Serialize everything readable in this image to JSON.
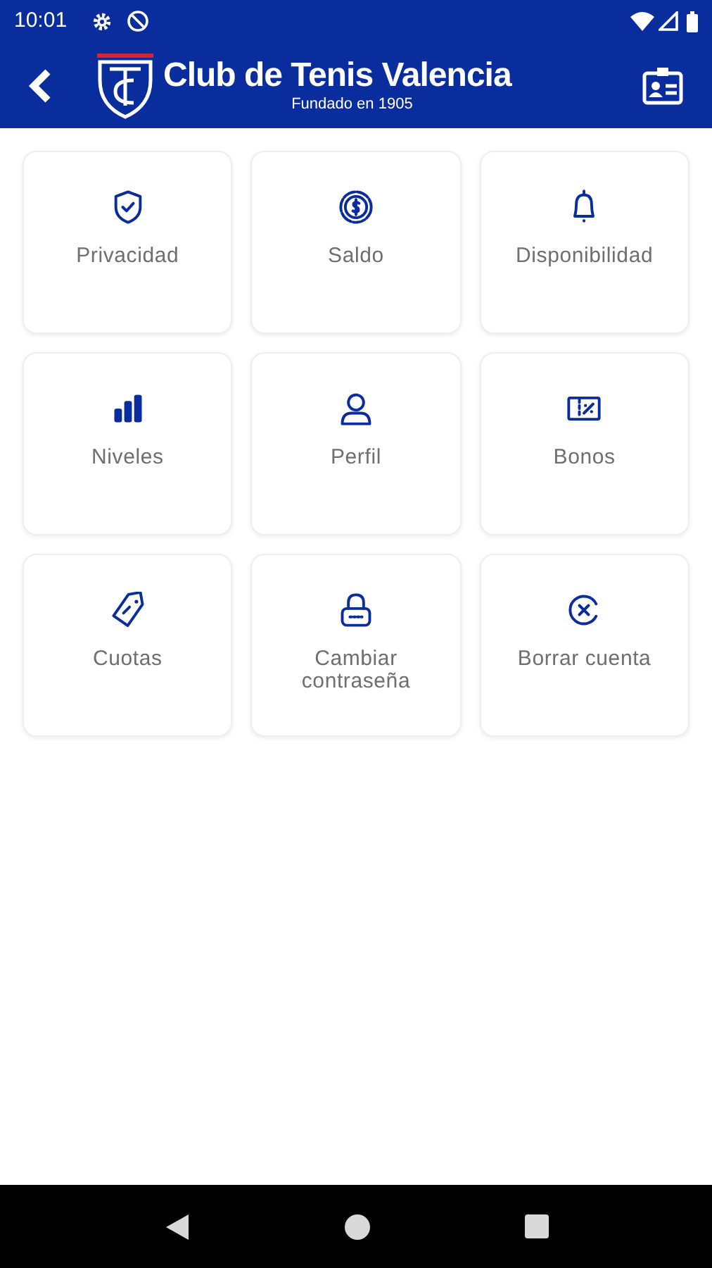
{
  "status_bar": {
    "time": "10:01"
  },
  "app_bar": {
    "title": "Club de Tenis Valencia",
    "subtitle": "Fundado en 1905"
  },
  "tiles": [
    {
      "label": "Privacidad"
    },
    {
      "label": "Saldo"
    },
    {
      "label": "Disponibilidad"
    },
    {
      "label": "Niveles"
    },
    {
      "label": "Perfil"
    },
    {
      "label": "Bonos"
    },
    {
      "label": "Cuotas"
    },
    {
      "label": "Cambiar contraseña"
    },
    {
      "label": "Borrar cuenta"
    }
  ]
}
